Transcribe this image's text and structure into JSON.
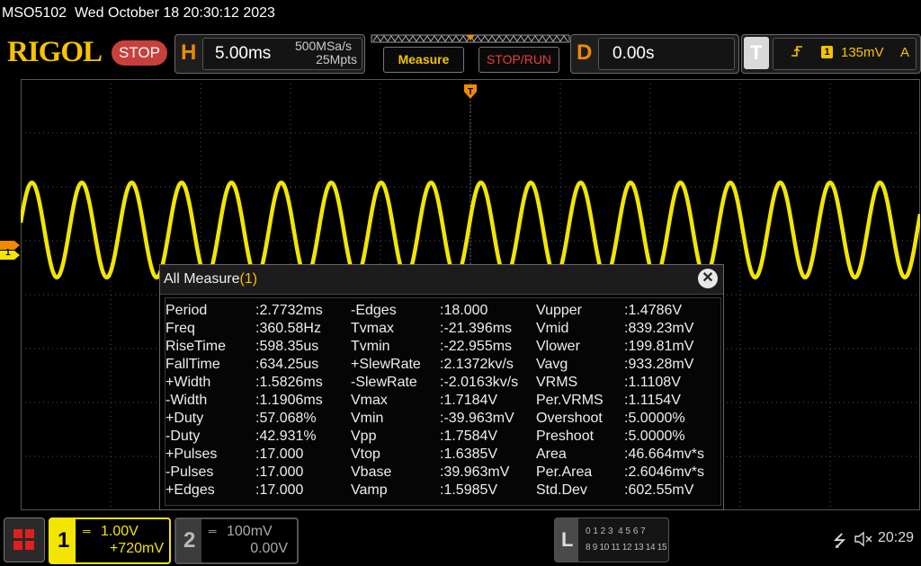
{
  "status": {
    "model": "MSO5102",
    "datetime": "Wed October 18 20:30:12 2023"
  },
  "brand": {
    "logo": "RIGOL",
    "run_state": "STOP"
  },
  "horizontal": {
    "letter": "H",
    "timebase": "5.00ms",
    "sample_rate": "500MSa/s",
    "memory_depth": "25Mpts"
  },
  "toolbar": {
    "measure_label": "Measure",
    "stoprun_label": "STOP/RUN"
  },
  "delay": {
    "letter": "D",
    "value": "0.00s"
  },
  "trigger": {
    "letter": "T",
    "source": "1",
    "level": "135mV",
    "mode": "A"
  },
  "markers": {
    "ch1_ground": "1"
  },
  "measure": {
    "title": "All Measure",
    "title_source": "(1)",
    "columns": [
      [
        {
          "name": "Period",
          "value": ":2.7732ms"
        },
        {
          "name": "Freq",
          "value": ":360.58Hz"
        },
        {
          "name": "RiseTime",
          "value": ":598.35us"
        },
        {
          "name": "FallTime",
          "value": ":634.25us"
        },
        {
          "name": "+Width",
          "value": ":1.5826ms"
        },
        {
          "name": "-Width",
          "value": ":1.1906ms"
        },
        {
          "name": "+Duty",
          "value": ":57.068%"
        },
        {
          "name": "-Duty",
          "value": ":42.931%"
        },
        {
          "name": "+Pulses",
          "value": ":17.000"
        },
        {
          "name": "-Pulses",
          "value": ":17.000"
        },
        {
          "name": "+Edges",
          "value": ":17.000"
        }
      ],
      [
        {
          "name": "-Edges",
          "value": ":18.000"
        },
        {
          "name": "Tvmax",
          "value": ":-21.396ms"
        },
        {
          "name": "Tvmin",
          "value": ":-22.955ms"
        },
        {
          "name": "+SlewRate",
          "value": ":2.1372kv/s"
        },
        {
          "name": "-SlewRate",
          "value": ":-2.0163kv/s"
        },
        {
          "name": "Vmax",
          "value": ":1.7184V"
        },
        {
          "name": "Vmin",
          "value": ":-39.963mV"
        },
        {
          "name": "Vpp",
          "value": ":1.7584V"
        },
        {
          "name": "Vtop",
          "value": ":1.6385V"
        },
        {
          "name": "Vbase",
          "value": ":39.963mV"
        },
        {
          "name": "Vamp",
          "value": ":1.5985V"
        }
      ],
      [
        {
          "name": "Vupper",
          "value": ":1.4786V"
        },
        {
          "name": "Vmid",
          "value": ":839.23mV"
        },
        {
          "name": "Vlower",
          "value": ":199.81mV"
        },
        {
          "name": "Vavg",
          "value": ":933.28mV"
        },
        {
          "name": "VRMS",
          "value": ":1.1108V"
        },
        {
          "name": "Per.VRMS",
          "value": ":1.1154V"
        },
        {
          "name": "Overshoot",
          "value": ":5.0000%"
        },
        {
          "name": "Preshoot",
          "value": ":5.0000%"
        },
        {
          "name": "Area",
          "value": ":46.664mv*s"
        },
        {
          "name": "Per.Area",
          "value": ":2.6046mv*s"
        },
        {
          "name": "Std.Dev",
          "value": ":602.55mV"
        }
      ]
    ]
  },
  "channel1": {
    "number": "1",
    "scale": "1.00V",
    "offset": "+720mV"
  },
  "channel2": {
    "number": "2",
    "scale": "100mV",
    "offset": "0.00V"
  },
  "logic": {
    "letter": "L",
    "row1": "0 1 2 3  4 5 6 7",
    "row2": "8 9 10 11 12 13 14 15"
  },
  "system": {
    "clock": "20:29"
  },
  "colors": {
    "ch1": "#f2e600",
    "accent": "#f08a00",
    "stop": "#c8403c"
  },
  "icons": [
    "menu-grid-icon",
    "usb-icon",
    "speaker-muted-icon",
    "trigger-edge-icon"
  ]
}
